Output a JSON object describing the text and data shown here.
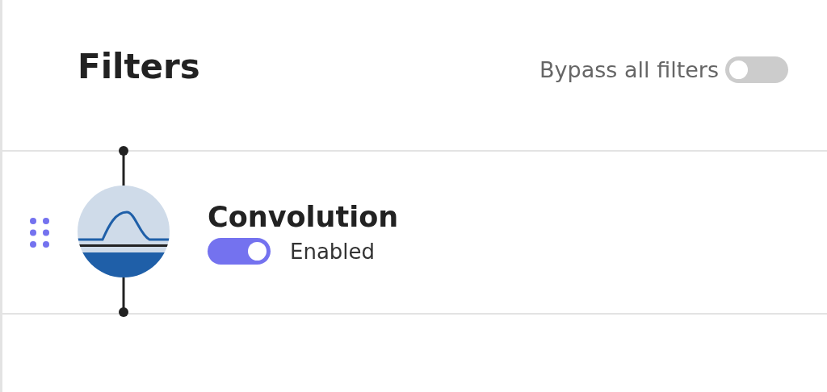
{
  "title": "Filters",
  "bypass": {
    "label": "Bypass all filters",
    "on": false
  },
  "filters": [
    {
      "name": "Convolution",
      "enabled": true,
      "status": "Enabled"
    }
  ]
}
